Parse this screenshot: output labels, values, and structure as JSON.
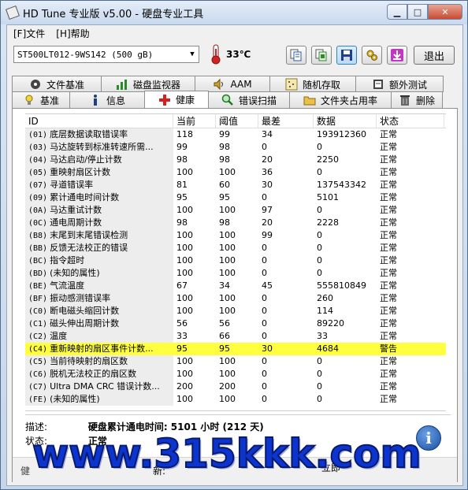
{
  "window": {
    "title": "HD Tune 专业版 v5.00 - 硬盘专业工具",
    "minimize": "▁",
    "maximize": "□",
    "close": "✕"
  },
  "menu": [
    {
      "label": "[F]文件"
    },
    {
      "label": "[H]帮助"
    }
  ],
  "toolbar": {
    "drive": "ST500LT012-9WS142 (500 gB)",
    "temperature": "33℃",
    "exit_label": "退出",
    "buttons": [
      "copy-text-icon",
      "copy-screenshot-icon",
      "save-icon",
      "options-icon",
      "download-icon"
    ]
  },
  "tabs_row1": [
    {
      "label": "文件基准",
      "icon": "file-benchmark-icon"
    },
    {
      "label": "磁盘监视器",
      "icon": "disk-monitor-icon"
    },
    {
      "label": "AAM",
      "icon": "speaker-icon"
    },
    {
      "label": "随机存取",
      "icon": "random-access-icon"
    },
    {
      "label": "额外测试",
      "icon": "extra-tests-icon"
    }
  ],
  "tabs_row2": [
    {
      "label": "基准",
      "icon": "benchmark-icon"
    },
    {
      "label": "信息",
      "icon": "info-icon"
    },
    {
      "label": "健康",
      "icon": "health-cross-icon",
      "active": true
    },
    {
      "label": "错误扫描",
      "icon": "error-scan-icon"
    },
    {
      "label": "文件夹占用率",
      "icon": "folder-usage-icon"
    },
    {
      "label": "删除",
      "icon": "erase-icon"
    }
  ],
  "grid": {
    "columns": [
      "ID",
      "当前",
      "阈值",
      "最差",
      "数据",
      "状态"
    ],
    "rows": [
      {
        "code": "(01)",
        "name": "底层数据读取错误率",
        "cur": "118",
        "thr": "99",
        "worst": "34",
        "data": "193912360",
        "status": "正常"
      },
      {
        "code": "(03)",
        "name": "马达旋转到标准转速所需...",
        "cur": "99",
        "thr": "98",
        "worst": "0",
        "data": "0",
        "status": "正常"
      },
      {
        "code": "(04)",
        "name": "马达启动/停止计数",
        "cur": "98",
        "thr": "98",
        "worst": "20",
        "data": "2250",
        "status": "正常"
      },
      {
        "code": "(05)",
        "name": "重映射扇区计数",
        "cur": "100",
        "thr": "100",
        "worst": "36",
        "data": "0",
        "status": "正常"
      },
      {
        "code": "(07)",
        "name": "寻道错误率",
        "cur": "81",
        "thr": "60",
        "worst": "30",
        "data": "137543342",
        "status": "正常"
      },
      {
        "code": "(09)",
        "name": "累计通电时间计数",
        "cur": "95",
        "thr": "95",
        "worst": "0",
        "data": "5101",
        "status": "正常"
      },
      {
        "code": "(0A)",
        "name": "马达重试计数",
        "cur": "100",
        "thr": "100",
        "worst": "97",
        "data": "0",
        "status": "正常"
      },
      {
        "code": "(0C)",
        "name": "通电周期计数",
        "cur": "98",
        "thr": "98",
        "worst": "20",
        "data": "2228",
        "status": "正常"
      },
      {
        "code": "(B8)",
        "name": "末尾到末尾错误检测",
        "cur": "100",
        "thr": "100",
        "worst": "99",
        "data": "0",
        "status": "正常"
      },
      {
        "code": "(BB)",
        "name": "反馈无法校正的错误",
        "cur": "100",
        "thr": "100",
        "worst": "0",
        "data": "0",
        "status": "正常"
      },
      {
        "code": "(BC)",
        "name": "指令超时",
        "cur": "100",
        "thr": "100",
        "worst": "0",
        "data": "0",
        "status": "正常"
      },
      {
        "code": "(BD)",
        "name": "(未知的属性)",
        "cur": "100",
        "thr": "100",
        "worst": "0",
        "data": "0",
        "status": "正常"
      },
      {
        "code": "(BE)",
        "name": "气流温度",
        "cur": "67",
        "thr": "34",
        "worst": "45",
        "data": "555810849",
        "status": "正常"
      },
      {
        "code": "(BF)",
        "name": "振动感测错误率",
        "cur": "100",
        "thr": "100",
        "worst": "0",
        "data": "260",
        "status": "正常"
      },
      {
        "code": "(C0)",
        "name": "断电磁头缩回计数",
        "cur": "100",
        "thr": "100",
        "worst": "0",
        "data": "114",
        "status": "正常"
      },
      {
        "code": "(C1)",
        "name": "磁头伸出周期计数",
        "cur": "56",
        "thr": "56",
        "worst": "0",
        "data": "89220",
        "status": "正常"
      },
      {
        "code": "(C2)",
        "name": "温度",
        "cur": "33",
        "thr": "66",
        "worst": "0",
        "data": "33",
        "status": "正常"
      },
      {
        "code": "(C4)",
        "name": "重新映射的扇区事件计数...",
        "cur": "95",
        "thr": "95",
        "worst": "30",
        "data": "4684",
        "status": "警告",
        "warn": true
      },
      {
        "code": "(C5)",
        "name": "当前待映射的扇区数",
        "cur": "100",
        "thr": "100",
        "worst": "0",
        "data": "0",
        "status": "正常"
      },
      {
        "code": "(C6)",
        "name": "脱机无法校正的扇区数",
        "cur": "100",
        "thr": "100",
        "worst": "0",
        "data": "0",
        "status": "正常"
      },
      {
        "code": "(C7)",
        "name": "Ultra DMA CRC 错误计数...",
        "cur": "200",
        "thr": "200",
        "worst": "0",
        "data": "0",
        "status": "正常"
      },
      {
        "code": "(FE)",
        "name": "(未知的属性)",
        "cur": "100",
        "thr": "100",
        "worst": "0",
        "data": "0",
        "status": "正常"
      }
    ]
  },
  "details": {
    "desc_label": "描述:",
    "desc_value": "硬盘累计通电时间: 5101 小时 (212 天)",
    "status_label": "状态:",
    "status_value": "正常",
    "info_glyph": "i"
  },
  "bottom": {
    "left_text": "健",
    "refresh_label": "新:",
    "refresh_button": "立即"
  },
  "watermark": "www.315kkk.com",
  "colors": {
    "warn_row": "#ffff40",
    "watermark": "#0c35d0"
  }
}
